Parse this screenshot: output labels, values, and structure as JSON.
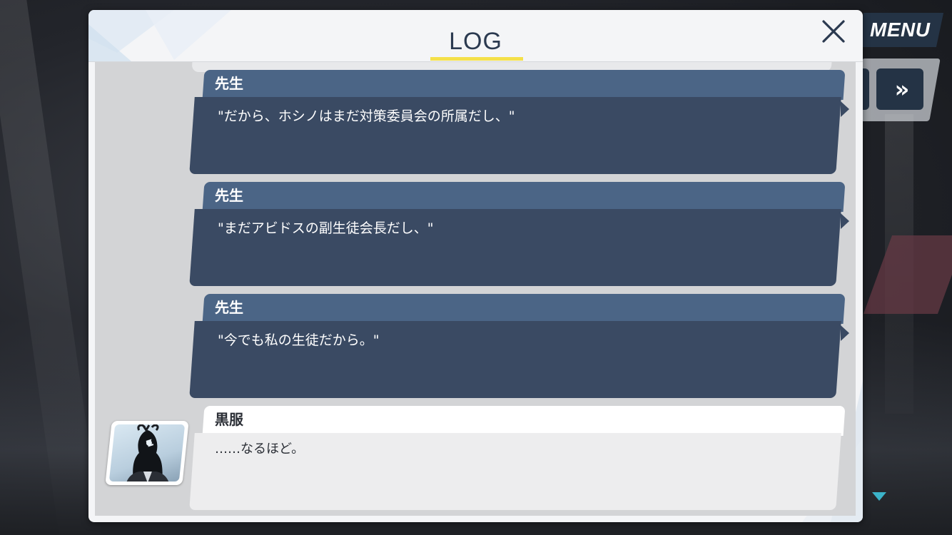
{
  "hud": {
    "menu_label": "MENU",
    "skip_label": "»"
  },
  "log": {
    "title": "LOG",
    "accent_color": "#f4e04a",
    "entries": [
      {
        "speaker": "先生",
        "text": "\"だから、ホシノはまだ対策委員会の所属だし、\"",
        "style": "dark"
      },
      {
        "speaker": "先生",
        "text": "\"まだアビドスの副生徒会長だし、\"",
        "style": "dark"
      },
      {
        "speaker": "先生",
        "text": "\"今でも私の生徒だから。\"",
        "style": "dark"
      },
      {
        "speaker": "黒服",
        "text": "……なるほど。",
        "style": "light",
        "has_avatar": true
      }
    ]
  },
  "icons": {
    "close": "close-icon",
    "scroll_down": "triangle-down-icon",
    "skip": "fast-forward-icon"
  },
  "colors": {
    "dark_bubble": "#3a4a63",
    "dark_name_bar": "#4b6586",
    "light_bubble": "#ededee",
    "header_text": "#2b3a50"
  }
}
